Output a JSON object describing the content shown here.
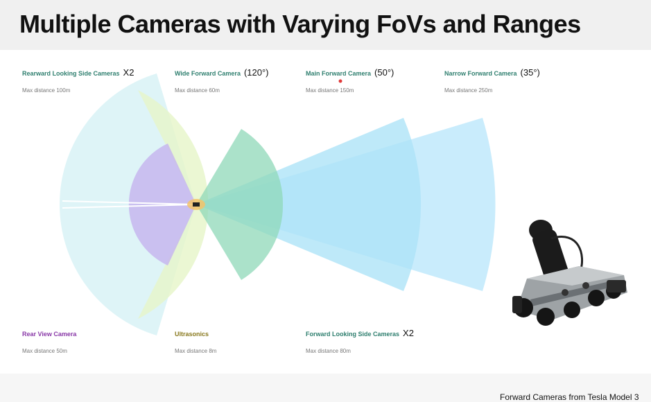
{
  "title": "Multiple Cameras with Varying FoVs and Ranges",
  "cameras": [
    {
      "id": "rearward-side",
      "name": "Rearward Looking Side Cameras",
      "extra": "X2",
      "distance": "Max distance 100m",
      "color": "#2f7f6f"
    },
    {
      "id": "wide-forward",
      "name": "Wide Forward Camera",
      "extra": "(120°)",
      "distance": "Max distance 60m",
      "color": "#2f7f6f"
    },
    {
      "id": "main-forward",
      "name": "Main Forward Camera",
      "extra": "(50°)",
      "distance": "Max distance 150m",
      "color": "#2f7f6f"
    },
    {
      "id": "narrow-forward",
      "name": "Narrow Forward Camera",
      "extra": "(35°)",
      "distance": "Max distance 250m",
      "color": "#2f7f6f"
    },
    {
      "id": "rear-view",
      "name": "Rear View Camera",
      "extra": "",
      "distance": "Max distance 50m",
      "color": "#8a3aa8"
    },
    {
      "id": "ultrasonics",
      "name": "Ultrasonics",
      "extra": "",
      "distance": "Max distance 8m",
      "color": "#8a7a20"
    },
    {
      "id": "forward-side",
      "name": "Forward Looking Side Cameras",
      "extra": "X2",
      "distance": "Max distance 80m",
      "color": "#2f7f6f"
    }
  ],
  "caption": "Forward Cameras from Tesla Model 3",
  "colors": {
    "rearward_side_fill": "#d8f2f6",
    "wide_forward_fill": "#e6f5c8",
    "main_forward_fill": "#aee4f7",
    "narrow_forward_fill": "#bfe9fb",
    "forward_side_fill": "#8fd8b8",
    "rear_view_fill": "#c7b6ee",
    "ultrasonic_fill": "#f4c36a"
  }
}
